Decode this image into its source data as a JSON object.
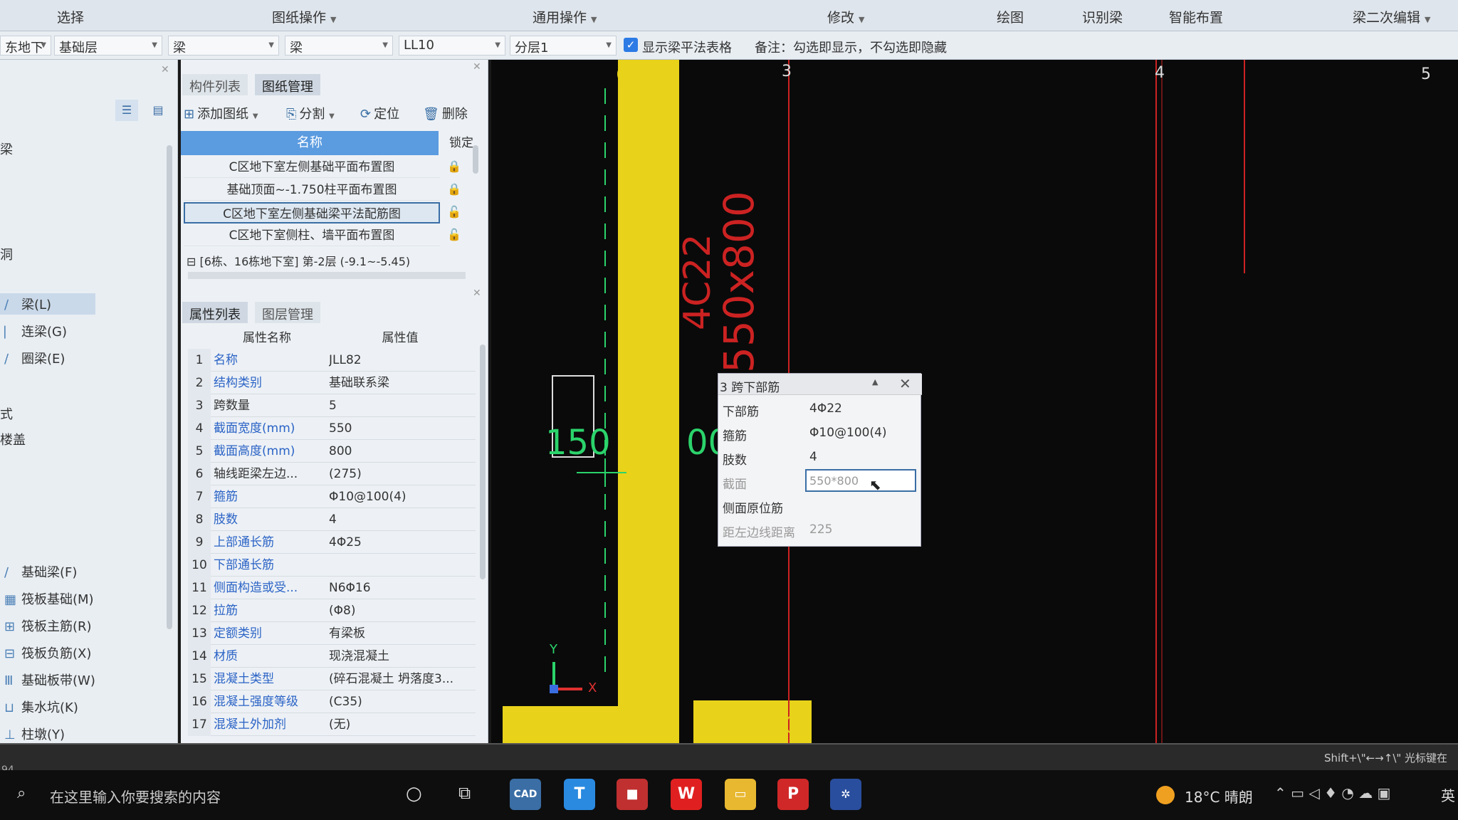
{
  "ribbon": {
    "select": "选择",
    "drawing_ops": "图纸操作",
    "general_ops": "通用操作",
    "modify": "修改",
    "draw": "绘图",
    "identify_beam": "识别梁",
    "smart_layout": "智能布置",
    "beam_edit": "梁二次编辑"
  },
  "toolbar": {
    "floor": "东地下",
    "layer": "基础层",
    "type1": "梁",
    "type2": "梁",
    "name": "LL10",
    "sublayer": "分层1",
    "show_table_label": "显示梁平法表格",
    "remark": "备注：勾选即显示，不勾选即隐藏"
  },
  "leftnav": {
    "items": [
      {
        "label": "梁(L)",
        "icon": "beam-icon",
        "selected": true
      },
      {
        "label": "连梁(G)",
        "icon": "link-beam-icon"
      },
      {
        "label": "圈梁(E)",
        "icon": "ring-beam-icon"
      },
      {
        "label": "基础梁(F)",
        "icon": "foundation-beam-icon"
      },
      {
        "label": "筏板基础(M)",
        "icon": "raft-icon"
      },
      {
        "label": "筏板主筋(R)",
        "icon": "raft-main-icon"
      },
      {
        "label": "筏板负筋(X)",
        "icon": "raft-neg-icon"
      },
      {
        "label": "基础板带(W)",
        "icon": "slab-band-icon"
      },
      {
        "label": "集水坑(K)",
        "icon": "sump-icon"
      },
      {
        "label": "柱墩(Y)",
        "icon": "pier-icon"
      }
    ],
    "partial_labels": [
      "梁",
      "洞",
      "式",
      "楼盖"
    ]
  },
  "drawings": {
    "tabs": [
      "构件列表",
      "图纸管理"
    ],
    "tools": [
      "添加图纸",
      "分割",
      "定位",
      "删除"
    ],
    "header_name": "名称",
    "header_lock": "锁定",
    "rows": [
      "C区地下室左侧基础平面布置图",
      "基础顶面~-1.750柱平面布置图",
      "C区地下室左侧基础梁平法配筋图",
      "C区地下室侧柱、墙平面布置图"
    ],
    "group": "[6栋、16栋地下室] 第-2层 (-9.1~-5.45)"
  },
  "properties": {
    "tabs": [
      "属性列表",
      "图层管理"
    ],
    "header_name": "属性名称",
    "header_value": "属性值",
    "rows": [
      {
        "n": "1",
        "name": "名称",
        "value": "JLL82",
        "blue": true
      },
      {
        "n": "2",
        "name": "结构类别",
        "value": "基础联系梁",
        "blue": true
      },
      {
        "n": "3",
        "name": "跨数量",
        "value": "5",
        "blue": false
      },
      {
        "n": "4",
        "name": "截面宽度(mm)",
        "value": "550",
        "blue": true
      },
      {
        "n": "5",
        "name": "截面高度(mm)",
        "value": "800",
        "blue": true
      },
      {
        "n": "6",
        "name": "轴线距梁左边...",
        "value": "(275)",
        "blue": false
      },
      {
        "n": "7",
        "name": "箍筋",
        "value": "Φ10@100(4)",
        "blue": true
      },
      {
        "n": "8",
        "name": "肢数",
        "value": "4",
        "blue": true
      },
      {
        "n": "9",
        "name": "上部通长筋",
        "value": "4Φ25",
        "blue": true
      },
      {
        "n": "10",
        "name": "下部通长筋",
        "value": "",
        "blue": true
      },
      {
        "n": "11",
        "name": "侧面构造或受...",
        "value": "N6Φ16",
        "blue": true
      },
      {
        "n": "12",
        "name": "拉筋",
        "value": "(Φ8)",
        "blue": true
      },
      {
        "n": "13",
        "name": "定额类别",
        "value": "有梁板",
        "blue": true
      },
      {
        "n": "14",
        "name": "材质",
        "value": "现浇混凝土",
        "blue": true
      },
      {
        "n": "15",
        "name": "混凝土类型",
        "value": "(碎石混凝土 坍落度3...",
        "blue": true
      },
      {
        "n": "16",
        "name": "混凝土强度等级",
        "value": "(C35)",
        "blue": true
      },
      {
        "n": "17",
        "name": "混凝土外加剂",
        "value": "(无)",
        "blue": true
      }
    ]
  },
  "canvas": {
    "axis_labels": [
      "3",
      "4",
      "5"
    ],
    "rebar_text": "4C22",
    "section_text": "550x800",
    "dim_text": "150",
    "dim_text2": "00",
    "axis_x": "X",
    "axis_y": "Y",
    "circle_label": "3"
  },
  "popup": {
    "title": "3 跨下部筋",
    "rows": [
      {
        "k": "下部筋",
        "v": "4Φ22",
        "dim": false
      },
      {
        "k": "箍筋",
        "v": "Φ10@100(4)",
        "dim": false
      },
      {
        "k": "肢数",
        "v": "4",
        "dim": false
      },
      {
        "k": "截面",
        "v": "550*800",
        "dim": true
      },
      {
        "k": "侧面原位筋",
        "v": "",
        "dim": false
      },
      {
        "k": "距左边线距离",
        "v": "225",
        "dim": true
      }
    ]
  },
  "statusbar": {
    "left": "94",
    "hint": "Shift+\\\"←→↑\\\" 光标键在"
  },
  "taskbar": {
    "search_placeholder": "在这里输入你要搜索的内容",
    "weather": "18°C 晴朗",
    "ime": "英"
  }
}
